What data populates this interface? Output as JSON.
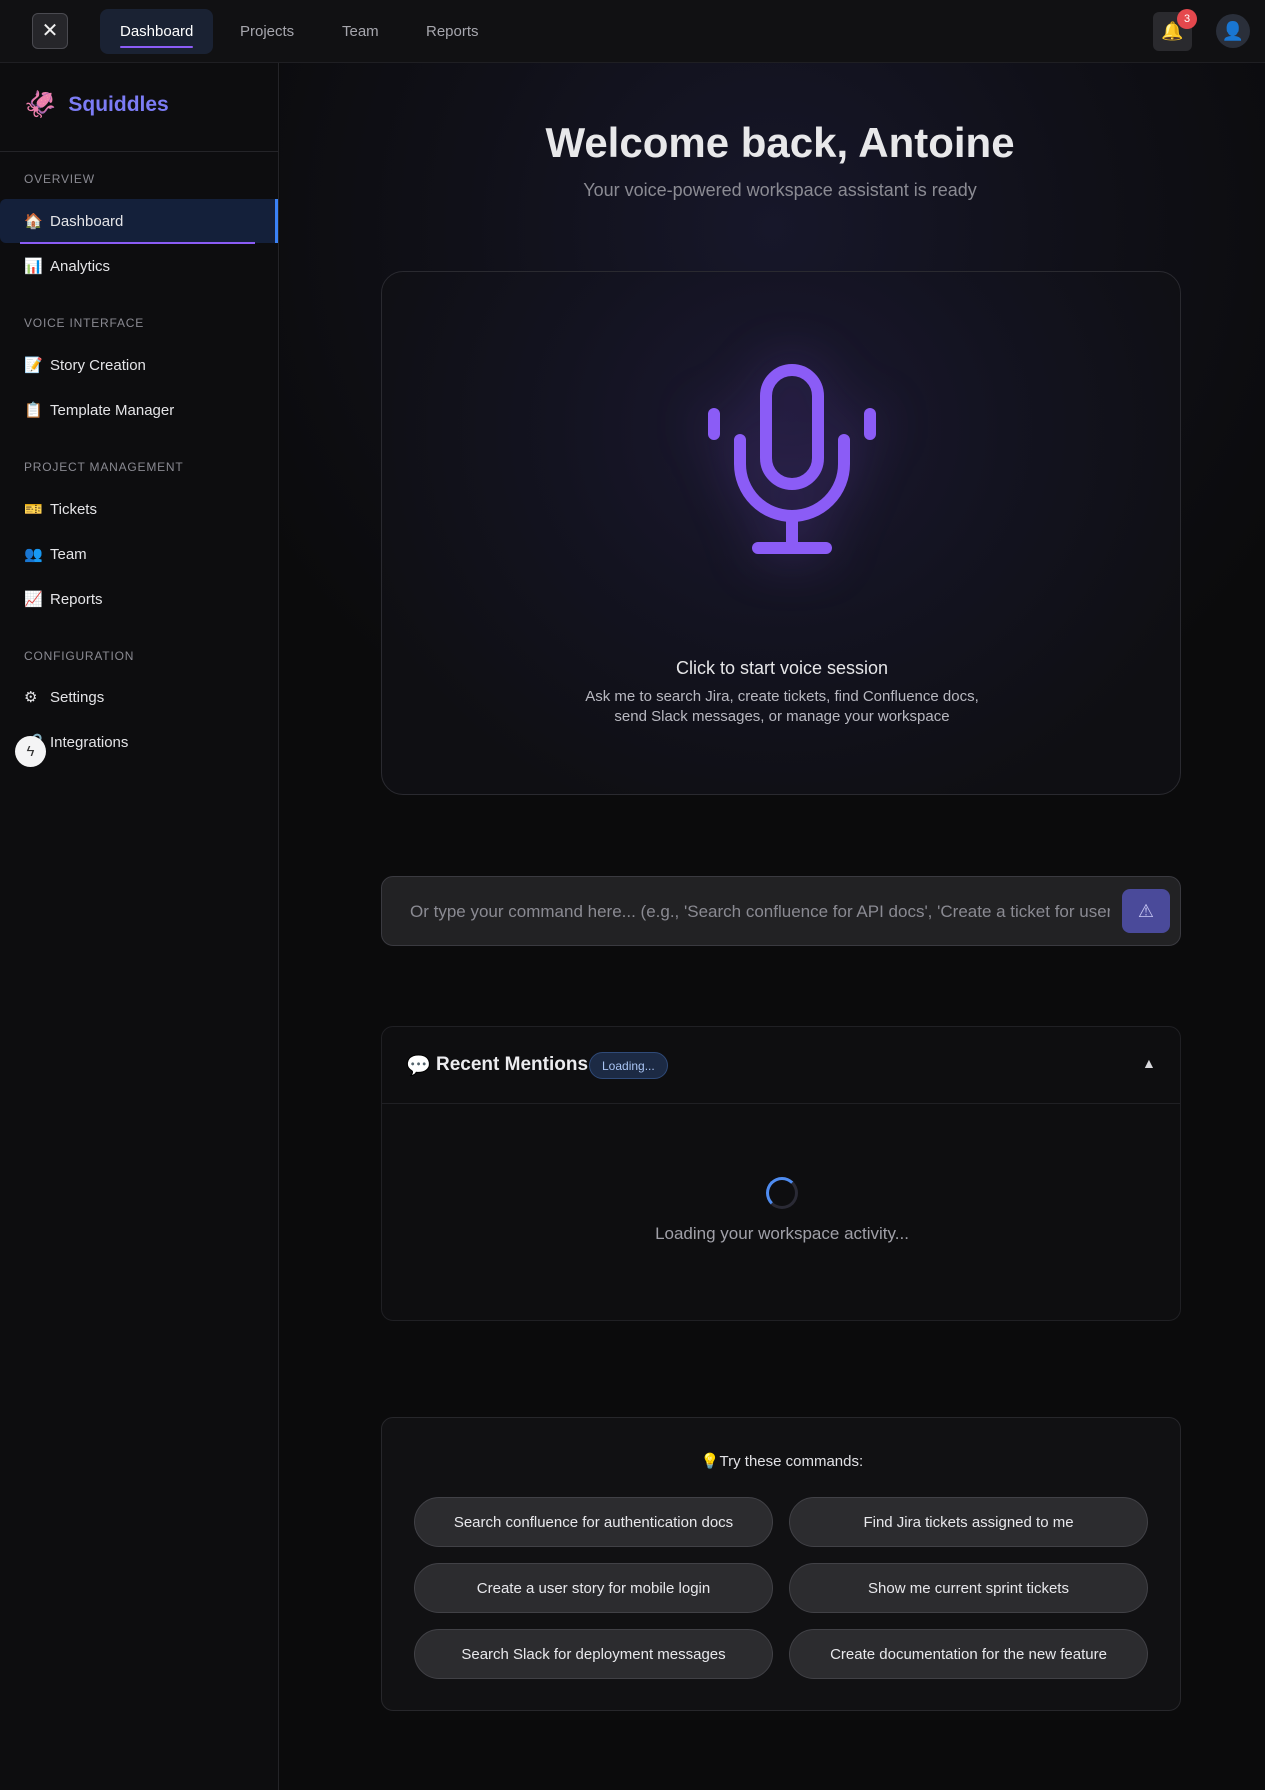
{
  "topbar": {
    "close_icon": "✕",
    "tabs": [
      {
        "label": "Dashboard",
        "active": true
      },
      {
        "label": "Projects",
        "active": false
      },
      {
        "label": "Team",
        "active": false
      },
      {
        "label": "Reports",
        "active": false
      }
    ],
    "bell_icon": "🔔",
    "notification_count": "3",
    "avatar_icon": "👤"
  },
  "sidebar": {
    "brand_icon": "🦑",
    "brand_name": "Squiddles",
    "sections": [
      {
        "title": "OVERVIEW",
        "items": [
          {
            "icon": "🏠",
            "label": "Dashboard",
            "active": true
          },
          {
            "icon": "📊",
            "label": "Analytics"
          }
        ]
      },
      {
        "title": "VOICE INTERFACE",
        "items": [
          {
            "icon": "📝",
            "label": "Story Creation"
          },
          {
            "icon": "📋",
            "label": "Template Manager"
          }
        ]
      },
      {
        "title": "PROJECT MANAGEMENT",
        "items": [
          {
            "icon": "🎫",
            "label": "Tickets"
          },
          {
            "icon": "👥",
            "label": "Team"
          },
          {
            "icon": "📈",
            "label": "Reports"
          }
        ]
      },
      {
        "title": "CONFIGURATION",
        "items": [
          {
            "icon": "⚙",
            "label": "Settings"
          },
          {
            "icon": "🔗",
            "label": "Integrations"
          }
        ]
      }
    ],
    "bolt_icon": "ϟ"
  },
  "main": {
    "welcome": "Welcome back, Antoine",
    "subtitle": "Your voice-powered workspace assistant is ready",
    "voice": {
      "title": "Click to start voice session",
      "description": "Ask me to search Jira, create tickets, find Confluence docs, send Slack messages, or manage your workspace",
      "accent_color": "#8b5cf6"
    },
    "command": {
      "placeholder": "Or type your command here... (e.g., 'Search confluence for API docs', 'Create a ticket for user login')",
      "send_icon": "⚠"
    },
    "mentions": {
      "icon": "💬",
      "title": "Recent Mentions",
      "status": "Loading...",
      "collapse_icon": "▲",
      "loading_text": "Loading your workspace activity..."
    },
    "tips": {
      "title": "💡Try these commands:",
      "commands": [
        "Search confluence for authentication docs",
        "Find Jira tickets assigned to me",
        "Create a user story for mobile login",
        "Show me current sprint tickets",
        "Search Slack for deployment messages",
        "Create documentation for the new feature"
      ]
    }
  }
}
